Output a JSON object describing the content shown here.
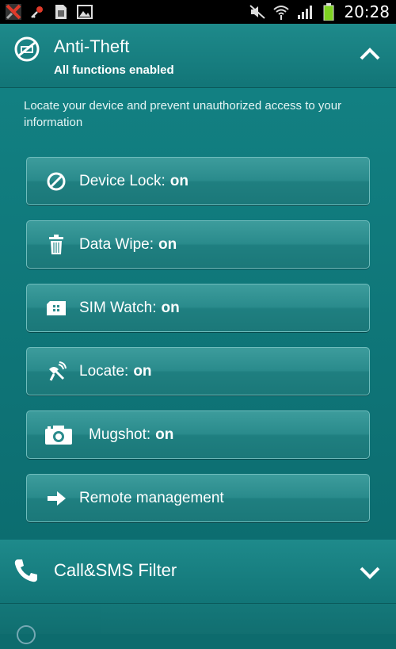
{
  "status_bar": {
    "time": "20:28",
    "icons_left": [
      "kaspersky-icon",
      "key-icon",
      "sim-card-icon",
      "gallery-icon"
    ],
    "icons_right": [
      "mute-icon",
      "wifi-icon",
      "signal-icon",
      "battery-icon"
    ]
  },
  "anti_theft": {
    "title": "Anti-Theft",
    "subtitle": "All functions enabled",
    "description": "Locate your device and prevent unauthorized access to your information",
    "expanded": true
  },
  "buttons": [
    {
      "id": "device-lock",
      "label": "Device Lock:",
      "state": "on",
      "icon": "lock-block-icon"
    },
    {
      "id": "data-wipe",
      "label": "Data Wipe:",
      "state": "on",
      "icon": "trash-icon"
    },
    {
      "id": "sim-watch",
      "label": "SIM Watch:",
      "state": "on",
      "icon": "sim-icon"
    },
    {
      "id": "locate",
      "label": "Locate:",
      "state": "on",
      "icon": "satellite-icon"
    },
    {
      "id": "mugshot",
      "label": "Mugshot:",
      "state": "on",
      "icon": "camera-icon"
    },
    {
      "id": "remote-management",
      "label": "Remote management",
      "state": "",
      "icon": "arrow-right-icon"
    }
  ],
  "call_sms": {
    "title": "Call&SMS Filter",
    "expanded": false
  },
  "colors": {
    "background": "#0d6b6d",
    "header": "#1e8a8b",
    "button": "#2a8b8c",
    "battery": "#7ed321"
  }
}
